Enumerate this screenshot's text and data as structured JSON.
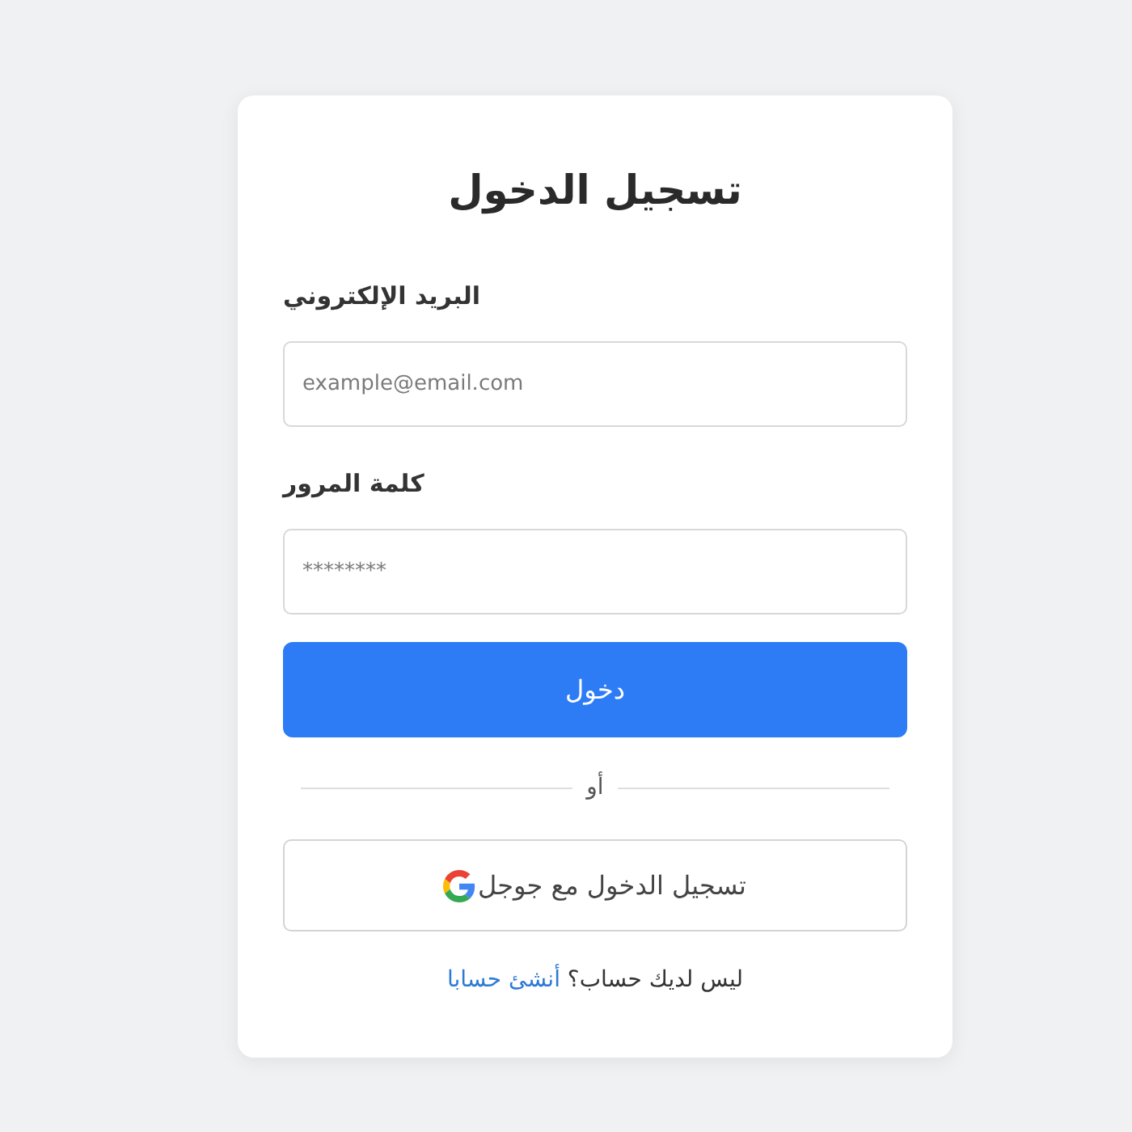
{
  "title": "تسجيل الدخول",
  "fields": [
    {
      "label": "البريد الإلكتروني",
      "placeholder": "example@email.com"
    },
    {
      "label": "كلمة المرور",
      "placeholder": "********"
    }
  ],
  "submit_button": "دخول",
  "divider": "أو",
  "google_button": "تسجيل الدخول مع جوجل",
  "footer": {
    "text": "ليس لديك حساب؟",
    "link": "أنشئ حسابا"
  }
}
